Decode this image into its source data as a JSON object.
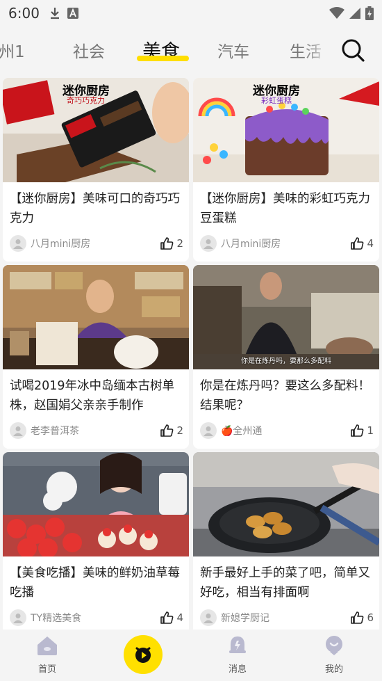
{
  "status_bar": {
    "time": "6:00"
  },
  "tabs": [
    {
      "label": "州1",
      "active": false
    },
    {
      "label": "社会",
      "active": false
    },
    {
      "label": "美食",
      "active": true
    },
    {
      "label": "汽车",
      "active": false
    },
    {
      "label": "生活",
      "active": false
    }
  ],
  "colors": {
    "accent": "#ffde00",
    "card_bg": "#ffffff",
    "page_bg": "#f4f4f4"
  },
  "cards": [
    {
      "title": "【迷你厨房】美味可口的奇巧巧克力",
      "author": "八月mini厨房",
      "likes": "2",
      "overlay_title": "迷你厨房",
      "overlay_subtitle": "奇巧巧克力"
    },
    {
      "title": "【迷你厨房】美味的彩虹巧克力豆蛋糕",
      "author": "八月mini厨房",
      "likes": "4",
      "overlay_title": "迷你厨房",
      "overlay_subtitle": "彩虹蛋糕"
    },
    {
      "title": "试喝2019年冰中岛缅本古树单株，赵国娟父亲亲手制作",
      "author": "老李普洱茶",
      "likes": "2"
    },
    {
      "title": "你是在炼丹吗？要这么多配料！结果呢？",
      "author": "🍎全州通",
      "likes": "1",
      "caption": "你是在炼丹吗，要那么多配料"
    },
    {
      "title": "【美食吃播】美味的鲜奶油草莓吃播",
      "author": "TY精选美食",
      "likes": "4"
    },
    {
      "title": "新手最好上手的菜了吧，简单又好吃，相当有排面啊",
      "author": "新媳学厨记",
      "likes": "6"
    }
  ],
  "bottom_nav": {
    "home": "首页",
    "messages": "消息",
    "mine": "我的"
  }
}
